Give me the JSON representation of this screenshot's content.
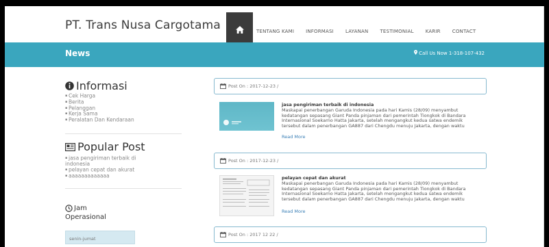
{
  "header": {
    "brand": "PT. Trans Nusa Cargotama",
    "home_icon": "home-icon",
    "nav": [
      "TENTANG KAMI",
      "INFORMASI",
      "LAYANAN",
      "TESTIMONIAL",
      "KARIR",
      "CONTACT"
    ]
  },
  "banner": {
    "title": "News",
    "phone": "Call Us Now 1-318-107-432",
    "pin_icon": "map-pin-icon"
  },
  "sidebar": {
    "info_title": "Informasi",
    "info_items": [
      "Cek Harga",
      "Berita",
      "Pelanggan",
      "Kerja Sama",
      "Peralatan Dan Kendaraan"
    ],
    "popular_title": "Popular Post",
    "popular_items": [
      "jasa pengiriman terbaik di indonesia",
      "pelayan cepat dan akurat",
      "aaaaaaaaaaaaa"
    ],
    "jam_title_1": "Jam",
    "jam_title_2": "Operasional",
    "jam_row": "senin-jumat"
  },
  "posts": [
    {
      "meta": "Post On : 2017-12-23 /",
      "title": "jasa pengiriman terbaik di indonesia",
      "text": "Maskapai penerbangan Garuda Indonesia pada hari Kamis (28/09) menyambut kedatangan sepasang Giant Panda pinjaman dari pemerintah Tiongkok di Bandara Internasional Soekarno Hatta Jakarta, setelah mengangkut kedua satwa endemik tersebut dalam penerbangan GA887 dari Chengdu menuju Jakarta, dengan waktu",
      "more": "Read More"
    },
    {
      "meta": "Post On : 2017-12-23 /",
      "title": "pelayan cepat dan akurat",
      "text": "Maskapai penerbangan Garuda Indonesia pada hari Kamis (28/09) menyambut kedatangan sepasang Giant Panda pinjaman dari pemerintah Tiongkok di Bandara Internasional Soekarno Hatta Jakarta, setelah mengangkut kedua satwa endemik tersebut dalam penerbangan GA887 dari Chengdu menuju Jakarta, dengan waktu",
      "more": "Read More"
    },
    {
      "meta": "Post On : 2017 12 22 /"
    }
  ],
  "colors": {
    "banner": "#3aa6be",
    "card_border": "#86b9cf",
    "link": "#3a7fb6"
  }
}
